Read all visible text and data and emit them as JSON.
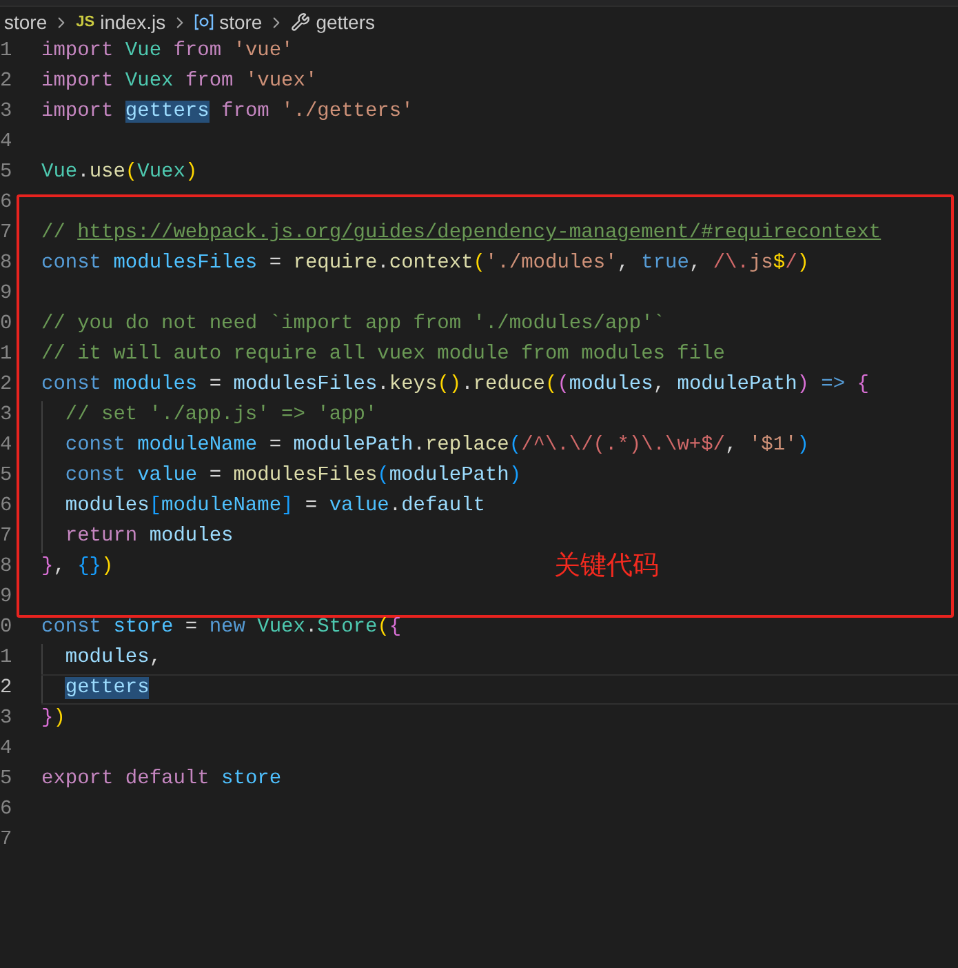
{
  "breadcrumb": [
    {
      "kind": "folder",
      "label": "store"
    },
    {
      "kind": "js-file",
      "icon_text": "JS",
      "label": "index.js"
    },
    {
      "kind": "symbol",
      "label": "store"
    },
    {
      "kind": "property",
      "label": "getters"
    }
  ],
  "code_sections": [
    {
      "kind": "plain",
      "lines": [
        {
          "number": "1",
          "tokens": [
            {
              "text": "import ",
              "kind": "kw"
            },
            {
              "text": "Vue ",
              "kind": "cls"
            },
            {
              "text": "from ",
              "kind": "kw"
            },
            {
              "text": "'vue'",
              "kind": "str"
            }
          ]
        },
        {
          "number": "2",
          "tokens": [
            {
              "text": "import ",
              "kind": "kw"
            },
            {
              "text": "Vuex ",
              "kind": "cls"
            },
            {
              "text": "from ",
              "kind": "kw"
            },
            {
              "text": "'vuex'",
              "kind": "str"
            }
          ]
        },
        {
          "number": "3",
          "tokens": [
            {
              "text": "import ",
              "kind": "kw"
            },
            {
              "text": "getters",
              "kind": "hl"
            },
            {
              "text": " from ",
              "kind": "kw"
            },
            {
              "text": "'./getters'",
              "kind": "str"
            }
          ]
        },
        {
          "number": "4"
        },
        {
          "number": "5",
          "tokens": [
            {
              "text": "Vue",
              "kind": "cls"
            },
            {
              "text": ".",
              "kind": "p"
            },
            {
              "text": "use",
              "kind": "fn"
            },
            {
              "text": "(",
              "kind": "b1"
            },
            {
              "text": "Vuex",
              "kind": "cls"
            },
            {
              "text": ")",
              "kind": "b1"
            }
          ]
        }
      ]
    },
    {
      "kind": "highlight_box",
      "label": "关键代码",
      "lines": [
        {
          "number": "6"
        },
        {
          "number": "7",
          "tokens": [
            {
              "text": "// ",
              "kind": "cm"
            },
            {
              "text": "https://webpack.js.org/guides/dependency-management/#requirecontext",
              "kind": "link"
            }
          ]
        },
        {
          "number": "8",
          "tokens": [
            {
              "text": "const ",
              "kind": "st"
            },
            {
              "text": "modulesFiles",
              "kind": "cv"
            },
            {
              "text": " = ",
              "kind": "p"
            },
            {
              "text": "require",
              "kind": "fn"
            },
            {
              "text": ".",
              "kind": "p"
            },
            {
              "text": "context",
              "kind": "fn"
            },
            {
              "text": "(",
              "kind": "b1"
            },
            {
              "text": "'./modules'",
              "kind": "str"
            },
            {
              "text": ", ",
              "kind": "p"
            },
            {
              "text": "true",
              "kind": "st"
            },
            {
              "text": ", ",
              "kind": "p"
            },
            {
              "text": "/\\.",
              "kind": "re"
            },
            {
              "text": "js",
              "kind": "str"
            },
            {
              "text": "$",
              "kind": "b1"
            },
            {
              "text": "/",
              "kind": "re"
            },
            {
              "text": ")",
              "kind": "b1"
            }
          ]
        },
        {
          "number": "9"
        },
        {
          "number": "0",
          "tokens": [
            {
              "text": "// you do not need `import app from './modules/app'`",
              "kind": "cm"
            }
          ]
        },
        {
          "number": "1",
          "tokens": [
            {
              "text": "// it will auto require all vuex module from modules file",
              "kind": "cm"
            }
          ]
        },
        {
          "number": "2",
          "tokens": [
            {
              "text": "const ",
              "kind": "st"
            },
            {
              "text": "modules",
              "kind": "cv"
            },
            {
              "text": " = ",
              "kind": "p"
            },
            {
              "text": "modulesFiles",
              "kind": "var"
            },
            {
              "text": ".",
              "kind": "p"
            },
            {
              "text": "keys",
              "kind": "fn"
            },
            {
              "text": "()",
              "kind": "b1"
            },
            {
              "text": ".",
              "kind": "p"
            },
            {
              "text": "reduce",
              "kind": "fn"
            },
            {
              "text": "(",
              "kind": "b1"
            },
            {
              "text": "(",
              "kind": "b2"
            },
            {
              "text": "modules",
              "kind": "var"
            },
            {
              "text": ", ",
              "kind": "p"
            },
            {
              "text": "modulePath",
              "kind": "var"
            },
            {
              "text": ")",
              "kind": "b2"
            },
            {
              "text": " => ",
              "kind": "st"
            },
            {
              "text": "{",
              "kind": "b2"
            }
          ]
        },
        {
          "number": "3",
          "guide": true,
          "tokens": [
            {
              "text": "// set './app.js' => 'app'",
              "kind": "cm"
            }
          ]
        },
        {
          "number": "4",
          "guide": true,
          "tokens": [
            {
              "text": "const ",
              "kind": "st"
            },
            {
              "text": "moduleName",
              "kind": "cv"
            },
            {
              "text": " = ",
              "kind": "p"
            },
            {
              "text": "modulePath",
              "kind": "var"
            },
            {
              "text": ".",
              "kind": "p"
            },
            {
              "text": "replace",
              "kind": "fn"
            },
            {
              "text": "(",
              "kind": "b3"
            },
            {
              "text": "/^\\.\\/(.*)\\.\\w+$/",
              "kind": "re"
            },
            {
              "text": ", ",
              "kind": "p"
            },
            {
              "text": "'$1'",
              "kind": "str"
            },
            {
              "text": ")",
              "kind": "b3"
            }
          ]
        },
        {
          "number": "5",
          "guide": true,
          "tokens": [
            {
              "text": "const ",
              "kind": "st"
            },
            {
              "text": "value",
              "kind": "cv"
            },
            {
              "text": " = ",
              "kind": "p"
            },
            {
              "text": "modulesFiles",
              "kind": "fn"
            },
            {
              "text": "(",
              "kind": "b3"
            },
            {
              "text": "modulePath",
              "kind": "var"
            },
            {
              "text": ")",
              "kind": "b3"
            }
          ]
        },
        {
          "number": "6",
          "guide": true,
          "tokens": [
            {
              "text": "modules",
              "kind": "var"
            },
            {
              "text": "[",
              "kind": "b3"
            },
            {
              "text": "moduleName",
              "kind": "cv"
            },
            {
              "text": "]",
              "kind": "b3"
            },
            {
              "text": " = ",
              "kind": "p"
            },
            {
              "text": "value",
              "kind": "cv"
            },
            {
              "text": ".",
              "kind": "p"
            },
            {
              "text": "default",
              "kind": "var"
            }
          ]
        },
        {
          "number": "7",
          "guide": true,
          "tokens": [
            {
              "text": "return ",
              "kind": "kw"
            },
            {
              "text": "modules",
              "kind": "var"
            }
          ]
        },
        {
          "number": "8",
          "tokens": [
            {
              "text": "}",
              "kind": "b2"
            },
            {
              "text": ", ",
              "kind": "p"
            },
            {
              "text": "{}",
              "kind": "b3"
            },
            {
              "text": ")",
              "kind": "b1"
            }
          ]
        },
        {
          "number": "9"
        }
      ]
    },
    {
      "kind": "plain",
      "lines": [
        {
          "number": "0",
          "tokens": [
            {
              "text": "const ",
              "kind": "st"
            },
            {
              "text": "store",
              "kind": "cv"
            },
            {
              "text": " = ",
              "kind": "p"
            },
            {
              "text": "new ",
              "kind": "st"
            },
            {
              "text": "Vuex",
              "kind": "cls"
            },
            {
              "text": ".",
              "kind": "p"
            },
            {
              "text": "Store",
              "kind": "cls"
            },
            {
              "text": "(",
              "kind": "b1"
            },
            {
              "text": "{",
              "kind": "b2"
            }
          ]
        },
        {
          "number": "1",
          "guide": true,
          "tokens": [
            {
              "text": "modules",
              "kind": "var"
            },
            {
              "text": ",",
              "kind": "p"
            }
          ]
        },
        {
          "number": "2",
          "guide": true,
          "current": true,
          "tokens": [
            {
              "text": "getters",
              "kind": "hl"
            }
          ]
        },
        {
          "number": "3",
          "tokens": [
            {
              "text": "}",
              "kind": "b2"
            },
            {
              "text": ")",
              "kind": "b1"
            }
          ]
        },
        {
          "number": "4"
        },
        {
          "number": "5",
          "tokens": [
            {
              "text": "export ",
              "kind": "kw"
            },
            {
              "text": "default ",
              "kind": "kw"
            },
            {
              "text": "store",
              "kind": "cv"
            }
          ]
        },
        {
          "number": "6"
        },
        {
          "number": "7"
        }
      ]
    }
  ]
}
